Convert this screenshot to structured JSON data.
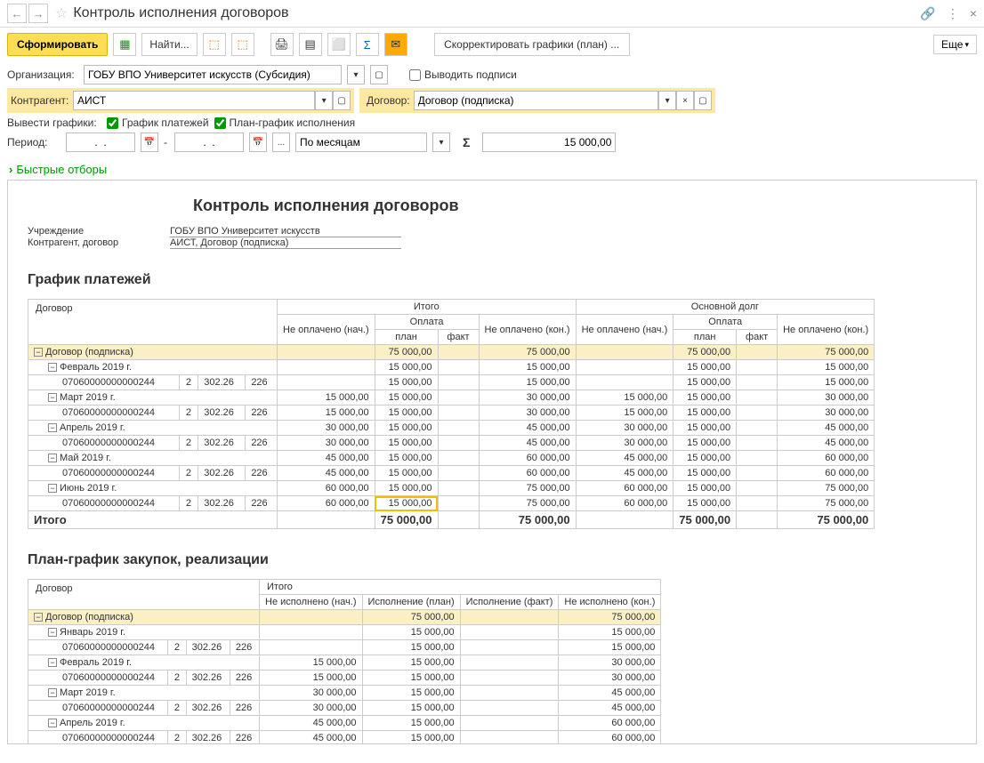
{
  "header": {
    "title": "Контроль исполнения договоров",
    "back": "←",
    "fwd": "→",
    "link_icon": "🔗",
    "more_icon": "⋮",
    "close_icon": "×"
  },
  "toolbar": {
    "generate": "Сформировать",
    "find": "Найти...",
    "more": "Еще",
    "adjust": "Скорректировать графики (план) ..."
  },
  "filters": {
    "org_label": "Организация:",
    "org_value": "ГОБУ ВПО Университет искусств (Субсидия)",
    "show_sign_label": "Выводить подписи",
    "kontr_label": "Контрагент:",
    "kontr_value": "АИСТ",
    "dogovor_label": "Договор:",
    "dogovor_value": "Договор (подписка)",
    "charts_label": "Вывести графики:",
    "chart1_label": "График платежей",
    "chart2_label": "План-график исполнения",
    "period_label": "Период:",
    "period_from": ".  .",
    "period_to": ".  .",
    "period_kind": "По месяцам",
    "sum": "15 000,00"
  },
  "quick_filters": "Быстрые отборы",
  "report": {
    "title": "Контроль исполнения договоров",
    "org_label": "Учреждение",
    "org_val": "ГОБУ ВПО Университет искусств",
    "kd_label": "Контрагент, договор",
    "kd_val": "АИСТ, Договор (подписка)",
    "sect1": "График платежей",
    "sect2": "План-график закупок, реализации",
    "hdr": {
      "dogovor": "Договор",
      "itogo": "Итого",
      "osn_dolg": "Основной долг",
      "ne_opl_nach": "Не оплачено (нач.)",
      "oplata": "Оплата",
      "plan": "план",
      "fakt": "факт",
      "ne_opl_kon": "Не оплачено (кон.)",
      "ne_isp_nach": "Не исполнено (нач.)",
      "isp_plan": "Исполнение (план)",
      "isp_fakt": "Исполнение (факт)",
      "ne_isp_kon": "Не исполнено (кон.)"
    },
    "code": "07060000000000244",
    "c2": "2",
    "c3": "302.26",
    "c4": "226",
    "payments": {
      "contract": {
        "name": "Договор (подписка)",
        "plan": "75 000,00",
        "kon": "75 000,00",
        "plan2": "75 000,00",
        "kon2": "75 000,00"
      },
      "months": [
        {
          "name": "Февраль 2019 г.",
          "nach": "",
          "plan": "15 000,00",
          "kon": "15 000,00",
          "nach2": "",
          "plan2": "15 000,00",
          "kon2": "15 000,00",
          "code_nach": "",
          "code_plan": "15 000,00",
          "code_kon": "15 000,00",
          "code_nach2": "",
          "code_plan2": "15 000,00",
          "code_kon2": "15 000,00"
        },
        {
          "name": "Март 2019 г.",
          "nach": "15 000,00",
          "plan": "15 000,00",
          "kon": "30 000,00",
          "nach2": "15 000,00",
          "plan2": "15 000,00",
          "kon2": "30 000,00",
          "code_nach": "15 000,00",
          "code_plan": "15 000,00",
          "code_kon": "30 000,00",
          "code_nach2": "15 000,00",
          "code_plan2": "15 000,00",
          "code_kon2": "30 000,00"
        },
        {
          "name": "Апрель 2019 г.",
          "nach": "30 000,00",
          "plan": "15 000,00",
          "kon": "45 000,00",
          "nach2": "30 000,00",
          "plan2": "15 000,00",
          "kon2": "45 000,00",
          "code_nach": "30 000,00",
          "code_plan": "15 000,00",
          "code_kon": "45 000,00",
          "code_nach2": "30 000,00",
          "code_plan2": "15 000,00",
          "code_kon2": "45 000,00"
        },
        {
          "name": "Май 2019 г.",
          "nach": "45 000,00",
          "plan": "15 000,00",
          "kon": "60 000,00",
          "nach2": "45 000,00",
          "plan2": "15 000,00",
          "kon2": "60 000,00",
          "code_nach": "45 000,00",
          "code_plan": "15 000,00",
          "code_kon": "60 000,00",
          "code_nach2": "45 000,00",
          "code_plan2": "15 000,00",
          "code_kon2": "60 000,00"
        },
        {
          "name": "Июнь 2019 г.",
          "nach": "60 000,00",
          "plan": "15 000,00",
          "kon": "75 000,00",
          "nach2": "60 000,00",
          "plan2": "15 000,00",
          "kon2": "75 000,00",
          "code_nach": "60 000,00",
          "code_plan": "15 000,00",
          "code_kon": "75 000,00",
          "code_nach2": "60 000,00",
          "code_plan2": "15 000,00",
          "code_kon2": "75 000,00",
          "hl": true
        }
      ],
      "total": {
        "name": "Итого",
        "plan": "75 000,00",
        "kon": "75 000,00",
        "plan2": "75 000,00",
        "kon2": "75 000,00"
      }
    },
    "exec": {
      "contract": {
        "name": "Договор (подписка)",
        "plan": "75 000,00",
        "kon": "75 000,00"
      },
      "months": [
        {
          "name": "Январь 2019 г.",
          "nach": "",
          "plan": "15 000,00",
          "kon": "15 000,00",
          "code_nach": "",
          "code_plan": "15 000,00",
          "code_kon": "15 000,00"
        },
        {
          "name": "Февраль 2019 г.",
          "nach": "15 000,00",
          "plan": "15 000,00",
          "kon": "30 000,00",
          "code_nach": "15 000,00",
          "code_plan": "15 000,00",
          "code_kon": "30 000,00"
        },
        {
          "name": "Март 2019 г.",
          "nach": "30 000,00",
          "plan": "15 000,00",
          "kon": "45 000,00",
          "code_nach": "30 000,00",
          "code_plan": "15 000,00",
          "code_kon": "45 000,00"
        },
        {
          "name": "Апрель 2019 г.",
          "nach": "45 000,00",
          "plan": "15 000,00",
          "kon": "60 000,00",
          "code_nach": "45 000,00",
          "code_plan": "15 000,00",
          "code_kon": "60 000,00"
        }
      ]
    }
  }
}
